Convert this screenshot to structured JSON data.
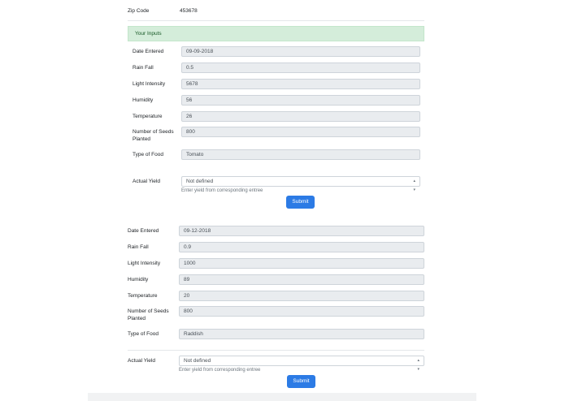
{
  "zip": {
    "label": "Zip Code",
    "value": "453678"
  },
  "banner": {
    "text": "Your Inputs"
  },
  "entry1": {
    "date": {
      "label": "Date Entered",
      "value": "09-09-2018"
    },
    "rain": {
      "label": "Rain Fall",
      "value": "0.5"
    },
    "light": {
      "label": "Light Intensity",
      "value": "5678"
    },
    "humidity": {
      "label": "Humidity",
      "value": "56"
    },
    "temperature": {
      "label": "Temperature",
      "value": "26"
    },
    "seeds": {
      "label_line1": "Number of Seeds",
      "label_line2": "Planted",
      "value": "800"
    },
    "food": {
      "label": "Type of Food",
      "value": "Tomato"
    },
    "yield": {
      "label": "Actual Yield",
      "selected": "Not defined",
      "help": "Enter yield from corresponding entree"
    },
    "submit_label": "Submit"
  },
  "entry2": {
    "date": {
      "label": "Date Entered",
      "value": "09-12-2018"
    },
    "rain": {
      "label": "Rain Fall",
      "value": "0.9"
    },
    "light": {
      "label": "Light Intensity",
      "value": "1000"
    },
    "humidity": {
      "label": "Humidity",
      "value": "89"
    },
    "temperature": {
      "label": "Temperature",
      "value": "20"
    },
    "seeds": {
      "label_line1": "Number of Seeds",
      "label_line2": "Planted",
      "value": "800"
    },
    "food": {
      "label": "Type of Food",
      "value": "Raddish"
    },
    "yield": {
      "label": "Actual Yield",
      "selected": "Not defined",
      "help": "Enter yield from corresponding entree"
    },
    "submit_label": "Submit"
  },
  "icons": {
    "select_caret": "chevron-up-down-icon"
  }
}
